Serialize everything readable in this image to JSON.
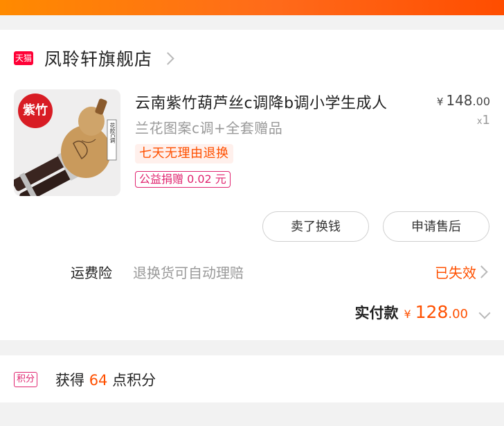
{
  "shop": {
    "badge": "天猫",
    "name": "凤聆轩旗舰店"
  },
  "product": {
    "image_badge": "紫竹",
    "image_caption": "花款C调",
    "title": "云南紫竹葫芦丝c调降b调小学生成人",
    "sku": "兰花图案c调+全套赠品",
    "price_currency": "¥",
    "price_int": "148",
    "price_dec": ".00",
    "qty_x": "x",
    "qty": "1",
    "tag_return": "七天无理由退换",
    "tag_charity": "公益捐赠 0.02 元"
  },
  "actions": {
    "sell_label": "卖了换钱",
    "aftersale_label": "申请售后"
  },
  "insurance": {
    "label": "运费险",
    "desc": "退换货可自动理赔",
    "status": "已失效"
  },
  "payment": {
    "label": "实付款",
    "currency": "¥",
    "amount_int": "128",
    "amount_dec": ".00"
  },
  "points": {
    "badge": "积分",
    "prefix": "获得",
    "value": "64",
    "suffix": "点积分"
  },
  "colors": {
    "accent": "#ff5000",
    "tmall_red": "#ff0036",
    "charity_pink": "#e0246f"
  }
}
